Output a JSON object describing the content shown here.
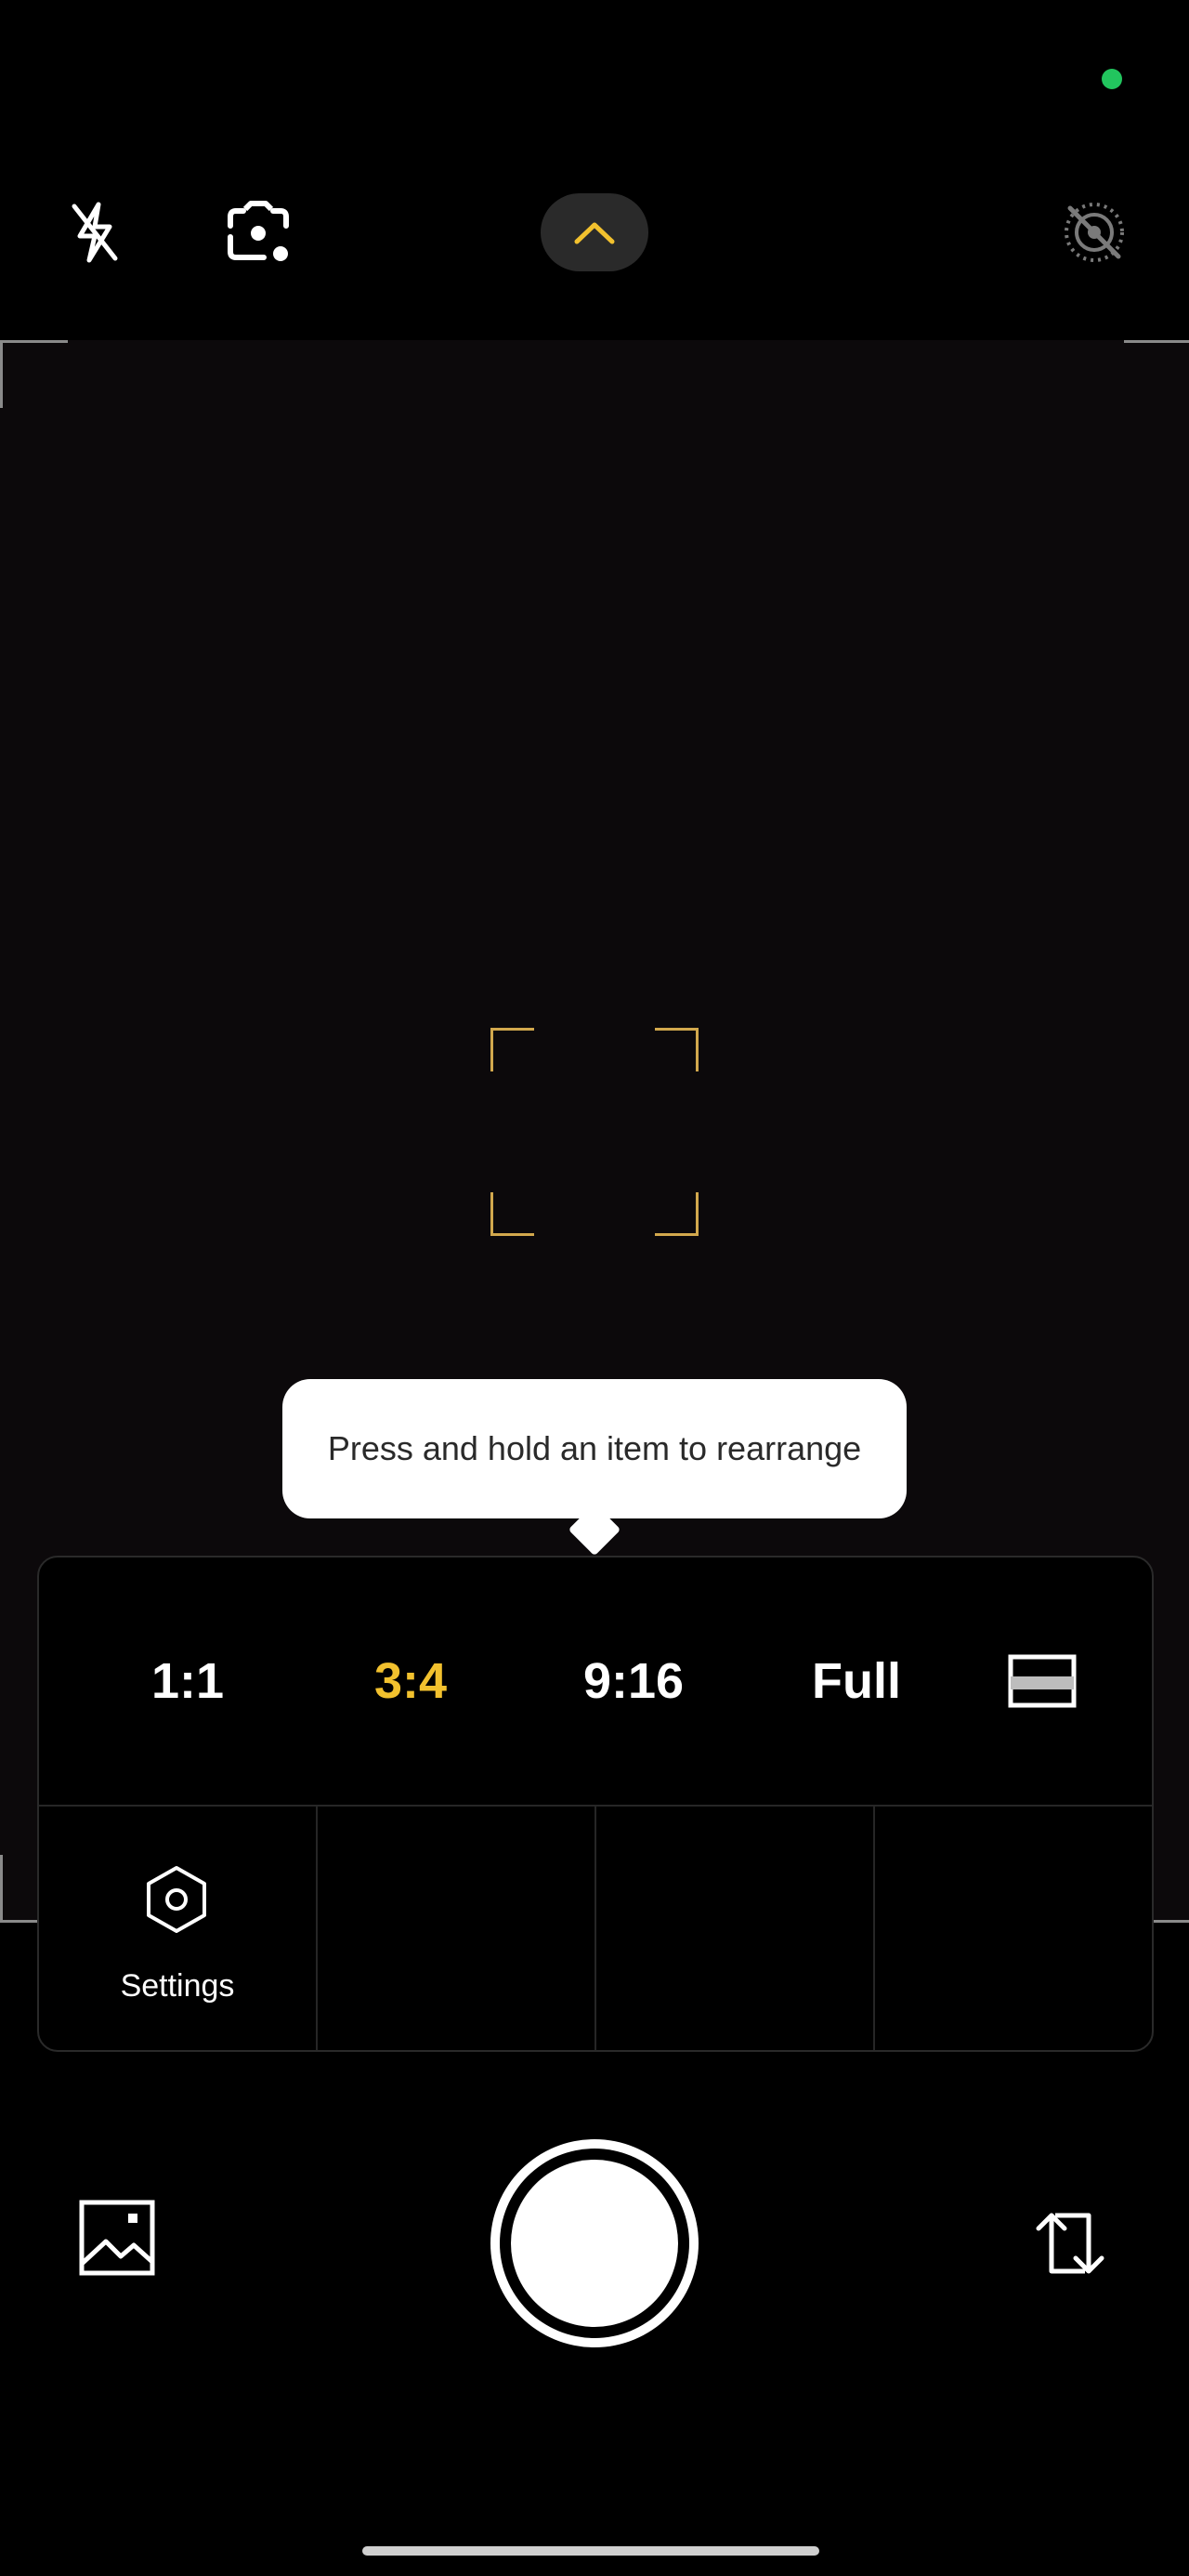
{
  "top_toolbar": {
    "icons": [
      "flash-off-icon",
      "camera-lens-icon",
      "chevron-up-icon",
      "live-photo-off-icon"
    ]
  },
  "tooltip": {
    "text": "Press and hold an item to rearrange"
  },
  "aspect_ratio_options": {
    "items": [
      {
        "label": "1:1",
        "selected": false
      },
      {
        "label": "3:4",
        "selected": true
      },
      {
        "label": "9:16",
        "selected": false
      },
      {
        "label": "Full",
        "selected": false
      }
    ],
    "extra_icon": "letterbox-ratio-icon"
  },
  "quick_settings": {
    "settings_label": "Settings"
  },
  "bottom_controls": {
    "icons": [
      "gallery-icon",
      "shutter-button",
      "switch-camera-icon"
    ]
  },
  "colors": {
    "accent": "#f2c12e",
    "privacy_indicator": "#22c55e",
    "focus_frame": "#d2a84d"
  }
}
